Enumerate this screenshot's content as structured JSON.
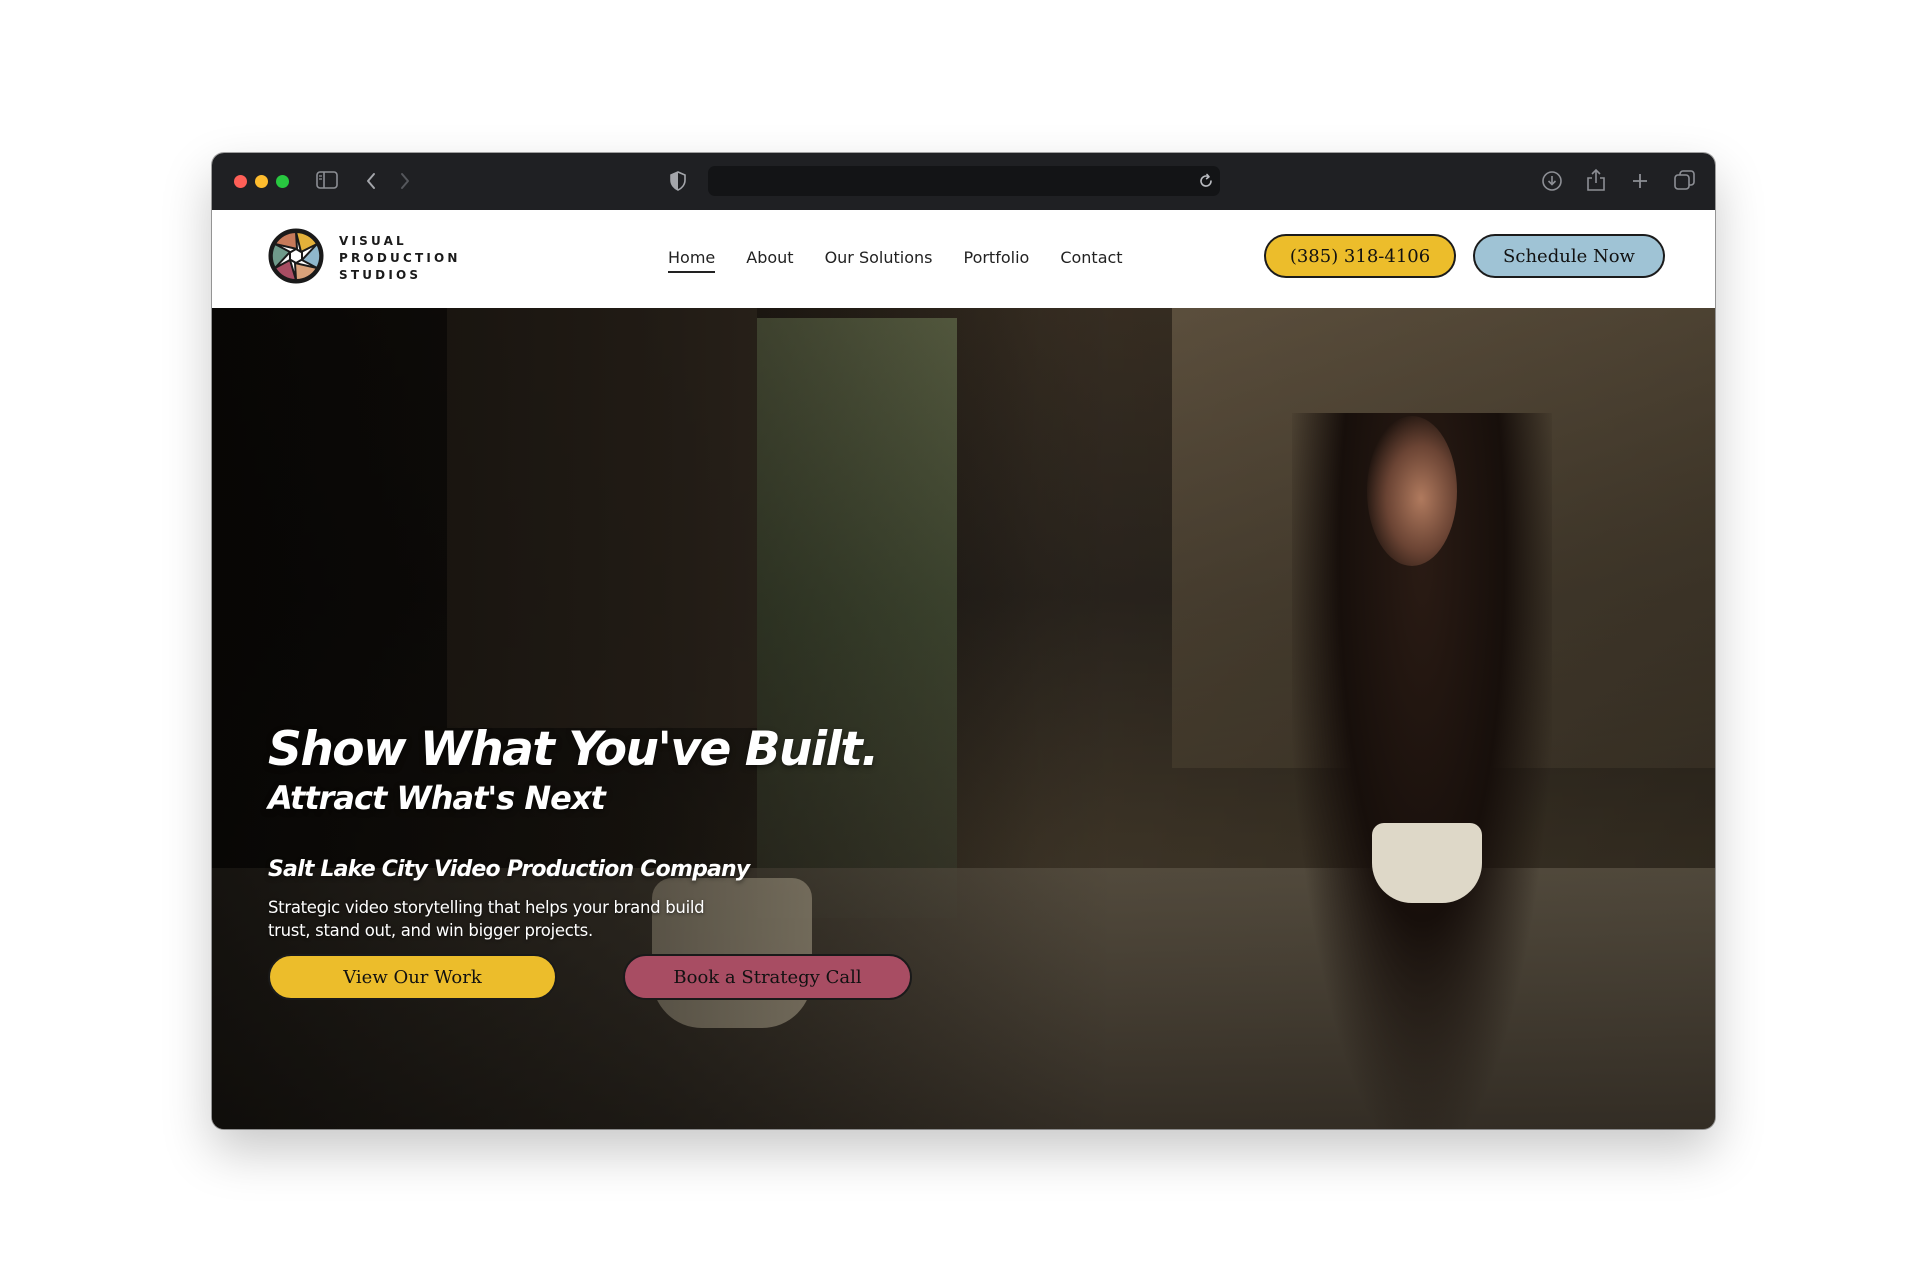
{
  "browser": {
    "traffic_lights": {
      "close": "#fe5f57",
      "minimize": "#febc2e",
      "maximize": "#28c840"
    },
    "address_text": ""
  },
  "site": {
    "logo": {
      "line1": "VISUAL",
      "line2": "PRODUCTION",
      "line3": "STUDIOS"
    },
    "nav": [
      {
        "label": "Home",
        "active": true
      },
      {
        "label": "About"
      },
      {
        "label": "Our Solutions"
      },
      {
        "label": "Portfolio"
      },
      {
        "label": "Contact"
      }
    ],
    "phone_button": {
      "label": "(385) 318-4106",
      "color": "#ecbd2b"
    },
    "schedule_button": {
      "label": "Schedule Now",
      "color": "#9fc3d5"
    }
  },
  "hero": {
    "headline": "Show What You've Built.",
    "subheadline": "Attract What's Next",
    "tagline": "Salt Lake City Video Production Company",
    "description": "Strategic video storytelling that helps your brand build trust, stand out, and win bigger projects.",
    "primary_cta": {
      "label": "View Our Work",
      "color": "#ecbd2b"
    },
    "secondary_cta": {
      "label": "Book a Strategy Call",
      "color": "#a84d63"
    }
  }
}
